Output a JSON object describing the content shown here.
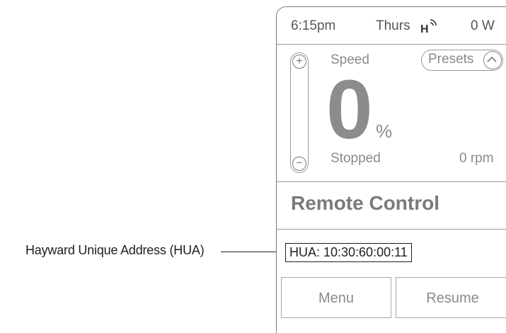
{
  "callout": {
    "label": "Hayward Unique Address (HUA)"
  },
  "status_bar": {
    "time": "6:15pm",
    "day": "Thurs",
    "power": "0 W",
    "icon": "hayward-wireless-icon"
  },
  "speed_panel": {
    "title": "Speed",
    "presets_label": "Presets",
    "value": "0",
    "unit": "%",
    "status": "Stopped",
    "rpm": "0 rpm",
    "slider_plus": "+",
    "slider_minus": "−"
  },
  "mode": {
    "label": "Remote Control"
  },
  "hua": {
    "label": "HUA: 10:30:60:00:11"
  },
  "buttons": {
    "menu": "Menu",
    "resume": "Resume"
  }
}
